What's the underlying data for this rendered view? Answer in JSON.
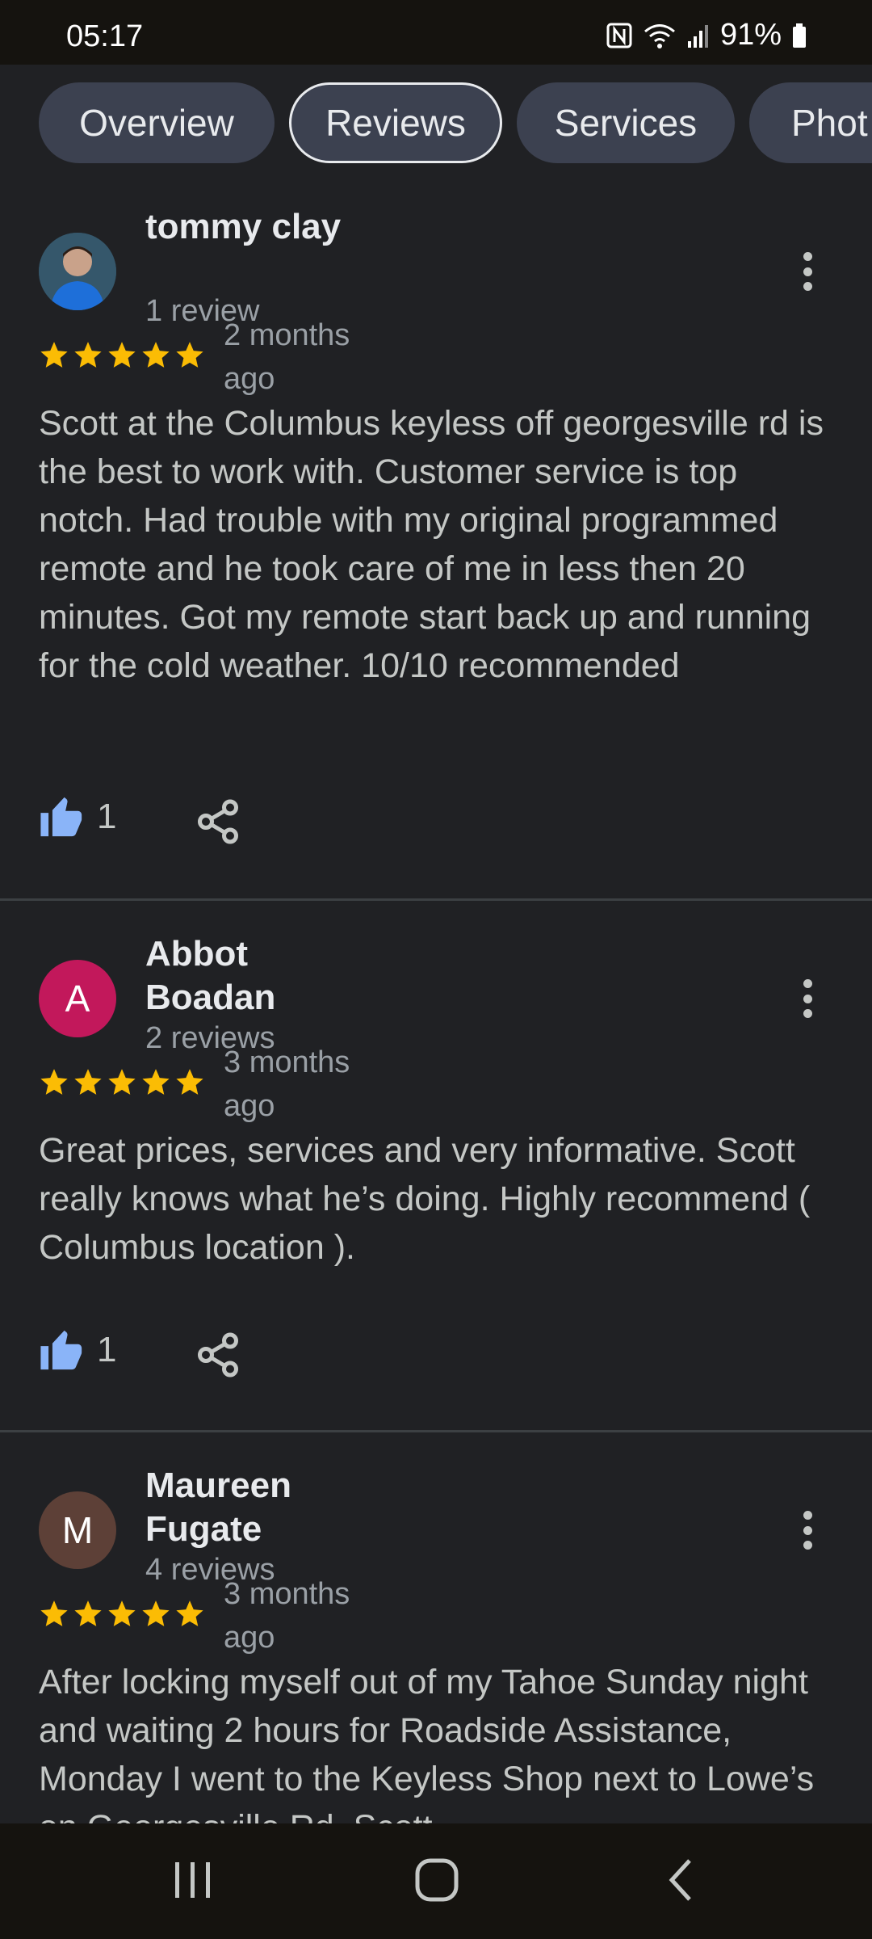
{
  "status": {
    "time": "05:17",
    "battery": "91%",
    "icons": [
      "nfc-icon",
      "wifi-icon",
      "signal-icon",
      "battery-icon"
    ]
  },
  "tabs": [
    {
      "label": "Overview"
    },
    {
      "label": "Reviews",
      "active": true
    },
    {
      "label": "Services"
    },
    {
      "label": "Phot"
    }
  ],
  "reviews": [
    {
      "name": "tommy clay",
      "count": "1 review",
      "rating": 5,
      "when": "2 months ago",
      "text": "Scott at the Columbus keyless off georgesville rd is the best to work with. Customer service is top notch. Had trouble with my original programmed remote and he took care of me in less then 20 minutes. Got my remote start back up and running for the cold weather. 10/10 recommended",
      "likes": "1",
      "avatar": {
        "type": "photo"
      }
    },
    {
      "name": "Abbot Boadan",
      "count": "2 reviews",
      "rating": 5,
      "when": "3 months ago",
      "text": "Great prices, services and very informative. Scott really knows what he’s doing. Highly recommend ( Columbus location ).",
      "likes": "1",
      "avatar": {
        "type": "letter",
        "letter": "A",
        "color": "#c2185b"
      }
    },
    {
      "name": "Maureen Fugate",
      "count": "4 reviews",
      "rating": 5,
      "when": "3 months ago",
      "text": "After locking myself out of my Tahoe Sunday night and waiting 2 hours for Roadside Assistance, Monday I went to the Keyless Shop next to Lowe’s on Georgesville Rd. Scott",
      "avatar": {
        "type": "letter",
        "letter": "M",
        "color": "#5d4037"
      }
    }
  ],
  "colors": {
    "star": "#fbbc04",
    "like": "#8ab4f8",
    "background": "#202124"
  },
  "nav": [
    "recent-apps-icon",
    "home-icon",
    "back-icon"
  ]
}
